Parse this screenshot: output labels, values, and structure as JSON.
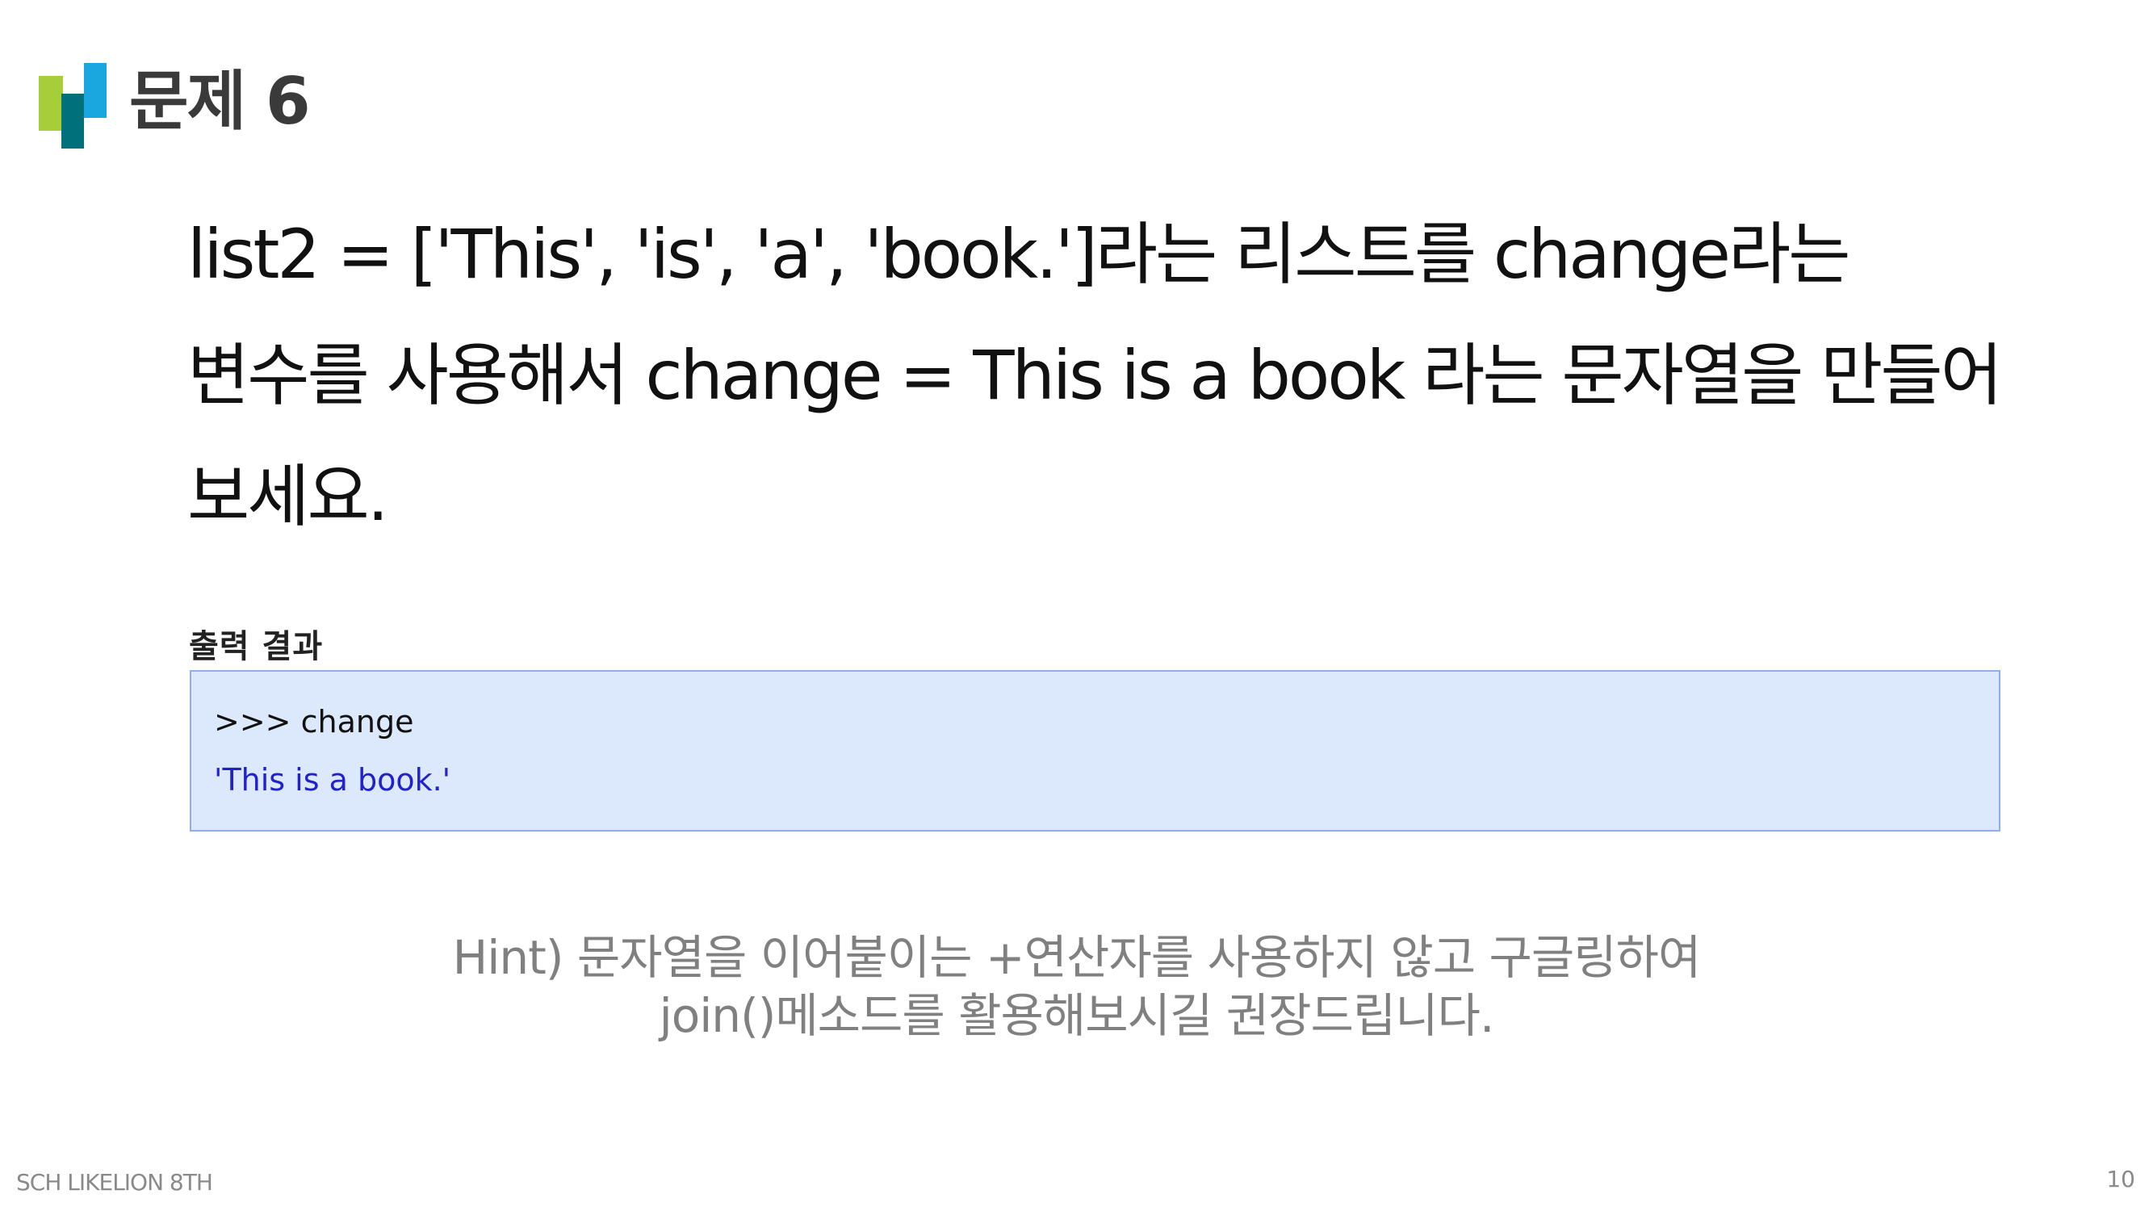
{
  "slide": {
    "title": "문제 6",
    "question_lines": [
      "list2 = ['This', 'is', 'a', 'book.']라는 리스트를 change라는",
      "변수를 사용해서 change = This is a book 라는 문자열을 만들어",
      "보세요."
    ],
    "output_label": "출력 결과",
    "output_lines": [
      ">>> change",
      "'This is a book.'"
    ],
    "hint_lines": [
      "Hint) 문자열을 이어붙이는 +연산자를 사용하지 않고 구글링하여",
      "join()메소드를 활용해보시길 권장드립니다."
    ],
    "footer_text": "SCH LIKELION 8TH",
    "page_number": "10"
  },
  "colors": {
    "logo_green": "#a6ce39",
    "logo_teal": "#00707a",
    "logo_blue": "#1aa6df",
    "output_bg": "#dce8fb",
    "output_border": "#8eaef0",
    "output_result_text": "#2222cc",
    "hint_text": "#808080"
  },
  "icons": {
    "logo": "bar-logo-icon"
  }
}
